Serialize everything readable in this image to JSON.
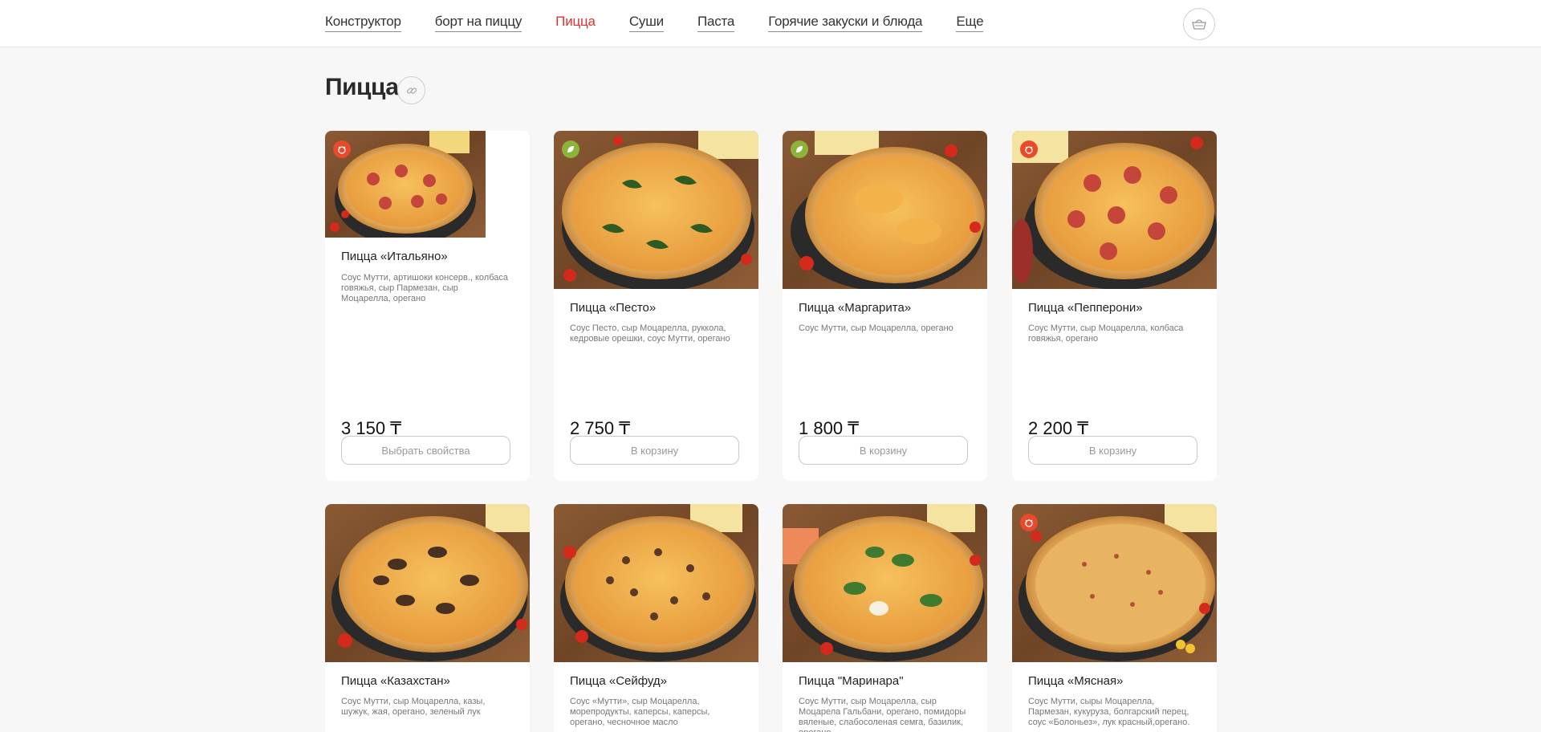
{
  "nav": {
    "items": [
      {
        "label": "Конструктор"
      },
      {
        "label": "борт на пиццу"
      },
      {
        "label": "Пицца"
      },
      {
        "label": "Суши"
      },
      {
        "label": "Паста"
      },
      {
        "label": "Горячие закуски и блюда"
      },
      {
        "label": "Еще"
      }
    ],
    "active_index": 2
  },
  "page": {
    "title": "Пицца"
  },
  "colors": {
    "accent": "#e53030",
    "meat_badge": "#e84a2b",
    "veg_badge": "#8db33a"
  },
  "products": [
    {
      "name": "Пицца «Итальяно»",
      "desc": "Соус Мутти, артишоки консерв., колбаса говяжья, сыр Пармезан, сыр Моцарелла, орегано",
      "price": "3 150 ₸",
      "button": "Выбрать свойства",
      "badge": "meat-icon"
    },
    {
      "name": "Пицца «Песто»",
      "desc": "Соус Песто, сыр Моцарелла, руккола, кедровые орешки, соус Мутти, орегано",
      "price": "2 750 ₸",
      "button": "В корзину",
      "badge": "leaf-icon"
    },
    {
      "name": "Пицца «Маргарита»",
      "desc": "Соус Мутти, сыр Моцарелла, орегано",
      "price": "1 800 ₸",
      "button": "В корзину",
      "badge": "leaf-icon"
    },
    {
      "name": "Пицца «Пепперони»",
      "desc": "Соус Мутти, сыр Моцарелла, колбаса говяжья, орегано",
      "price": "2 200 ₸",
      "button": "В корзину",
      "badge": "meat-icon"
    },
    {
      "name": "Пицца «Казахстан»",
      "desc": "Соус Мутти, сыр Моцарелла, казы, шужук, жая, орегано, зеленый лук"
    },
    {
      "name": "Пицца «Сейфуд»",
      "desc": "Соус «Мутти», сыр Моцарелла, морепродукты, каперсы, каперсы, орегано, чесночное масло"
    },
    {
      "name": "Пицца \"Маринара\"",
      "desc": "Соус Мутти, сыр Моцарелла, сыр Моцарела Гальбани, орегано, помидоры вяленые, слабосоленая семга, базилик, орегано"
    },
    {
      "name": "Пицца «Мясная»",
      "desc": "Соус  Мутти, сыры Моцарелла, Пармезан, кукуруза, болгарский перец, соус «Болоньез», лук красный,орегано.",
      "badge": "meat-icon"
    }
  ]
}
